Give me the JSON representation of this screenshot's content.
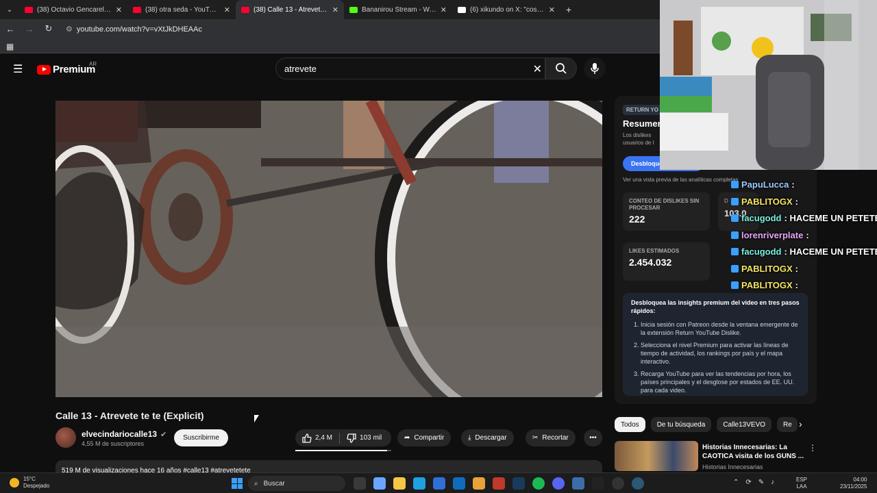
{
  "browser": {
    "tabs": [
      {
        "label": "(38) Octavio Gencarelli - YouTub",
        "favicon": "youtube-icon",
        "color": "#ff0033",
        "active": false
      },
      {
        "label": "(38) otra seda - YouTube",
        "favicon": "youtube-icon",
        "color": "#ff0033",
        "active": false
      },
      {
        "label": "(38) Calle 13 - Atrevete te t",
        "favicon": "youtube-icon",
        "color": "#ff0033",
        "active": true
      },
      {
        "label": "Bananirou Stream - Watch Live",
        "favicon": "kick-icon",
        "color": "#53fc18",
        "active": false
      },
      {
        "label": "(6) xikundo on X: \"coscu reacc",
        "favicon": "x-icon",
        "color": "#ffffff",
        "active": false
      }
    ],
    "url": "youtube.com/watch?v=vXtJkDHEAAc"
  },
  "youtube": {
    "logo_text": "Premium",
    "country_code": "AR",
    "search_value": "atrevete",
    "video_title": "Calle 13 - Atrevete te te (Explicit)",
    "channel_name": "elvecindariocalle13",
    "subscribers": "4,55 M de suscriptores",
    "subscribe_label": "Suscribirme",
    "likes": "2,4 M",
    "dislikes": "103 mil",
    "like_ratio": 0.959,
    "share_label": "Compartir",
    "download_label": "Descargar",
    "clip_label": "Recortar",
    "description_preview": "519 M de visualizaciones  hace 16 años  #calle13 #atrevetetete"
  },
  "ryd_panel": {
    "badge": "RETURN YO",
    "title": "Resumen",
    "subtitle": "Los dislikes usuarios de l",
    "button_label": "Desbloque",
    "preview_link": "Ver una vista previa de las analíticas completas",
    "raw_dislikes_label": "CONTEO DE DISLIKES SIN PROCESAR",
    "raw_dislikes_value": "222",
    "second_label": "D",
    "second_value": "103.0",
    "est_likes_label": "LIKES ESTIMADOS",
    "est_likes_value": "2.454.032",
    "insights_heading": "Desbloquea las insights premium del video en tres pasos rápidos:",
    "steps": [
      "Inicia sesión con Patreon desde la ventana emergente de la extensión Return YouTube Dislike.",
      "Selecciona el nivel Premium para activar las líneas de tiempo de actividad, los rankings por país y el mapa interactivo.",
      "Recarga YouTube para ver las tendencias por hora, los países principales y el desglose por estados de EE. UU. para cada video."
    ]
  },
  "chips": [
    "Todos",
    "De tu búsqueda",
    "Calle13VEVO",
    "Re"
  ],
  "recommendation": {
    "title": "Historias Innecesarias: La CAOTICA visita de los GUNS ...",
    "channel": "Historias Innecesarias"
  },
  "chat": [
    {
      "user": "PapuLucca",
      "msg": ":",
      "color": "#9ecbff"
    },
    {
      "user": "PABLITOGX",
      "msg": ":",
      "color": "#f5e663"
    },
    {
      "user": "facugodd",
      "msg": ": HACEME UN PETETE",
      "color": "#7af0e0"
    },
    {
      "user": "lorenriverplate",
      "msg": ":",
      "color": "#e9a8ff"
    },
    {
      "user": "facugodd",
      "msg": ": HACEME UN PETETE",
      "color": "#7af0e0"
    },
    {
      "user": "PABLITOGX",
      "msg": ":",
      "color": "#f5e663"
    },
    {
      "user": "PABLITOGX",
      "msg": ":",
      "color": "#f5e663"
    }
  ],
  "taskbar": {
    "temperature": "15°C",
    "weather": "Despejado",
    "search_label": "Buscar",
    "lang_top": "ESP",
    "lang_bottom": "LAA",
    "time": "04:00",
    "date": "23/11/2025"
  }
}
